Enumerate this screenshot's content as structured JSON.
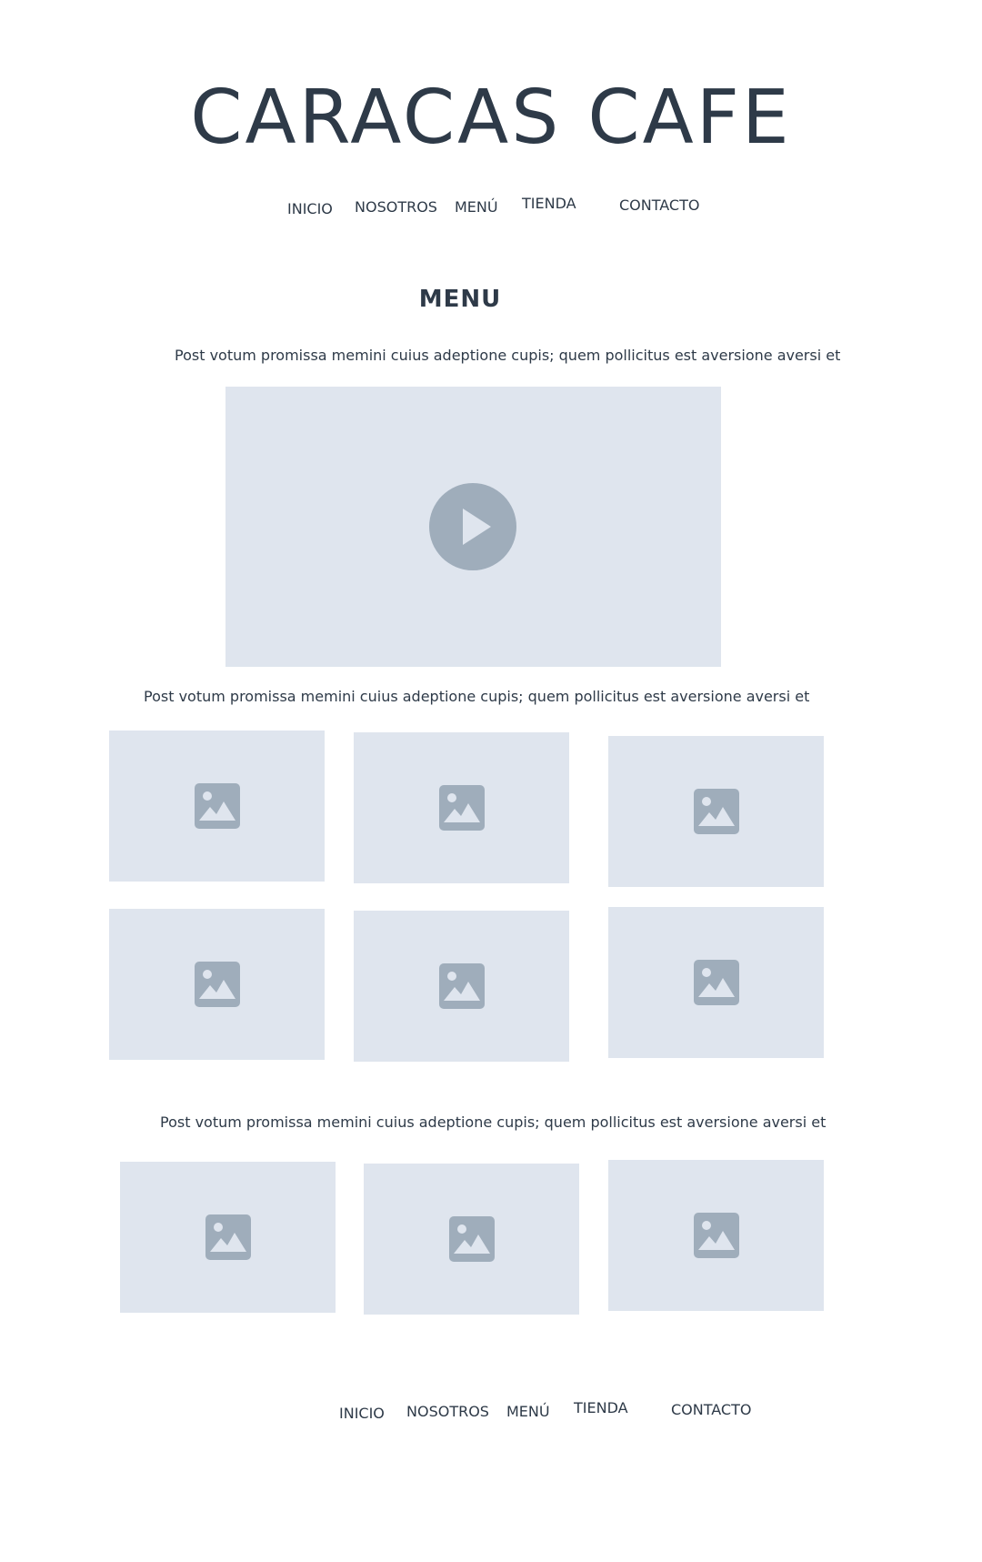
{
  "header": {
    "title": "CARACAS CAFE"
  },
  "nav_top": {
    "items": [
      {
        "label": "INICIO"
      },
      {
        "label": "NOSOTROS"
      },
      {
        "label": "MENÚ"
      },
      {
        "label": "TIENDA"
      },
      {
        "label": "CONTACTO"
      }
    ]
  },
  "main": {
    "heading": "MENU",
    "paragraph_1": "Post votum promissa memini cuius adeptione cupis; quem pollicitus est aversione aversi et",
    "video": {
      "icon": "play-icon"
    },
    "paragraph_2": "Post votum promissa memini cuius adeptione cupis; quem pollicitus est aversione aversi et",
    "gallery_1": {
      "icon": "image-placeholder-icon",
      "count": 6
    },
    "paragraph_3": "Post votum promissa memini cuius adeptione cupis; quem pollicitus est aversione aversi et",
    "gallery_2": {
      "icon": "image-placeholder-icon",
      "count": 3
    }
  },
  "nav_bottom": {
    "items": [
      {
        "label": "INICIO"
      },
      {
        "label": "NOSOTROS"
      },
      {
        "label": "MENÚ"
      },
      {
        "label": "TIENDA"
      },
      {
        "label": "CONTACTO"
      }
    ]
  },
  "colors": {
    "text": "#2e3a48",
    "placeholder_bg": "#dfe5ee",
    "placeholder_icon": "#9fadbb",
    "background": "#ffffff"
  }
}
